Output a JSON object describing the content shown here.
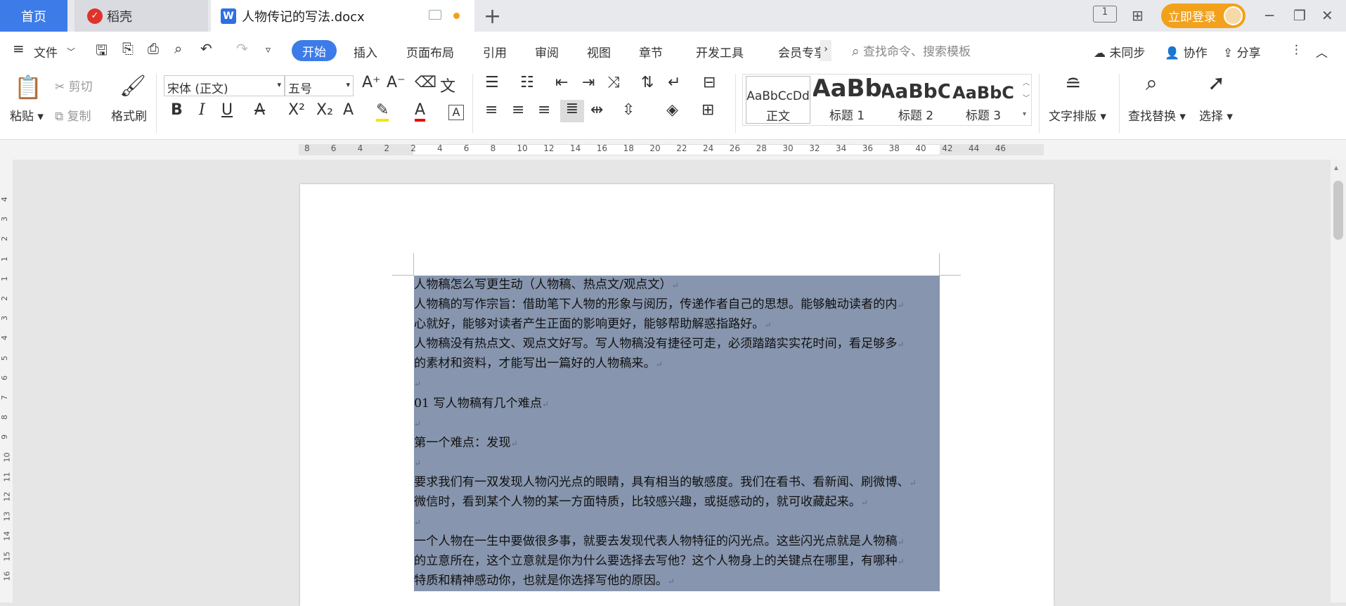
{
  "tabs": {
    "home": "首页",
    "daoke": "稻壳",
    "doc": "人物传记的写法.docx",
    "doc_icon": "W"
  },
  "titlebar": {
    "login": "立即登录",
    "page_badge": "1"
  },
  "menu": {
    "file": "文件",
    "items": [
      "开始",
      "插入",
      "页面布局",
      "引用",
      "审阅",
      "视图",
      "章节",
      "开发工具",
      "会员专享"
    ],
    "search_placeholder": "查找命令、搜索模板",
    "sync": "未同步",
    "collab": "协作",
    "share": "分享"
  },
  "ribbon": {
    "paste": "粘贴",
    "cut": "剪切",
    "copy": "复制",
    "format_painter": "格式刷",
    "font": "宋体 (正文)",
    "size": "五号",
    "styles": [
      {
        "preview": "AaBbCcDd",
        "label": "正文"
      },
      {
        "preview": "AaBb",
        "label": "标题 1"
      },
      {
        "preview": "AaBbC",
        "label": "标题 2"
      },
      {
        "preview": "AaBbC",
        "label": "标题 3"
      }
    ],
    "text_layout": "文字排版",
    "find_replace": "查找替换",
    "select": "选择"
  },
  "ruler": {
    "numbers": [
      "8",
      "6",
      "4",
      "2",
      "2",
      "4",
      "6",
      "8",
      "10",
      "12",
      "14",
      "16",
      "18",
      "20",
      "22",
      "24",
      "26",
      "28",
      "30",
      "32",
      "34",
      "36",
      "38",
      "40",
      "42",
      "44",
      "46"
    ],
    "v_numbers": [
      "4",
      "3",
      "2",
      "1",
      "1",
      "2",
      "3",
      "4",
      "5",
      "6",
      "7",
      "8",
      "9",
      "10",
      "11",
      "12",
      "13",
      "14",
      "15",
      "16"
    ]
  },
  "doc": {
    "paragraphs": [
      "人物稿怎么写更生动（人物稿、热点文/观点文）",
      "人物稿的写作宗旨：借助笔下人物的形象与阅历，传递作者自己的思想。能够触动读者的内",
      "心就好，能够对读者产生正面的影响更好，能够帮助解惑指路好。",
      "人物稿没有热点文、观点文好写。写人物稿没有捷径可走，必须踏踏实实花时间，看足够多",
      "的素材和资料，才能写出一篇好的人物稿来。",
      "",
      "01 写人物稿有几个难点",
      "",
      "第一个难点：发现",
      "",
      "要求我们有一双发现人物闪光点的眼睛，具有相当的敏感度。我们在看书、看新闻、刷微博、",
      "微信时，看到某个人物的某一方面特质，比较感兴趣，或挺感动的，就可收藏起来。",
      "",
      "一个人物在一生中要做很多事，就要去发现代表人物特征的闪光点。这些闪光点就是人物稿",
      "的立意所在，这个立意就是你为什么要选择去写他？这个人物身上的关键点在哪里，有哪种",
      "特质和精神感动你，也就是你选择写他的原因。"
    ]
  }
}
